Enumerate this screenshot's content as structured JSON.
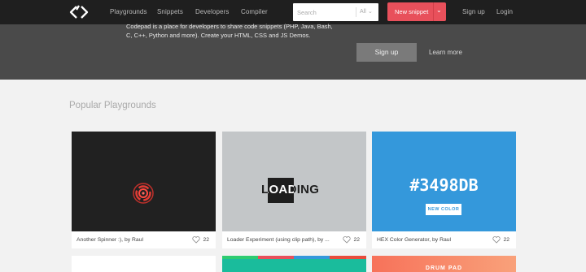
{
  "nav": {
    "links": [
      "Playgrounds",
      "Snippets",
      "Developers",
      "Compiler"
    ],
    "search_placeholder": "Search",
    "filter_value": "All",
    "new_snippet_label": "New snippet",
    "signup": "Sign up",
    "login": "Login"
  },
  "hero": {
    "text": "Codepad is a place for developers to share code snippets (PHP, Java, Bash, C, C++, Python and more). Create your HTML, CSS and JS Demos.",
    "signup_button": "Sign up",
    "learn_more": "Learn more"
  },
  "section": {
    "title": "Popular Playgrounds"
  },
  "cards": [
    {
      "caption": "Another Spinner :), by Raul",
      "likes": "22"
    },
    {
      "caption": "Loader Experiment (using clip path), by ...",
      "likes": "22",
      "thumb_text": "LOADING"
    },
    {
      "caption": "HEX Color Generator, by Raul",
      "likes": "22",
      "thumb_title": "#3498DB",
      "thumb_button": "NEW COLOR"
    }
  ],
  "partial_cards": [
    {
      "thumb_text": "DRUM PAD"
    }
  ],
  "colors": {
    "topbar": "#1f1f1f",
    "hero": "#4a4a4a",
    "accent": "#e8505b",
    "hex_blue": "#3498db"
  }
}
